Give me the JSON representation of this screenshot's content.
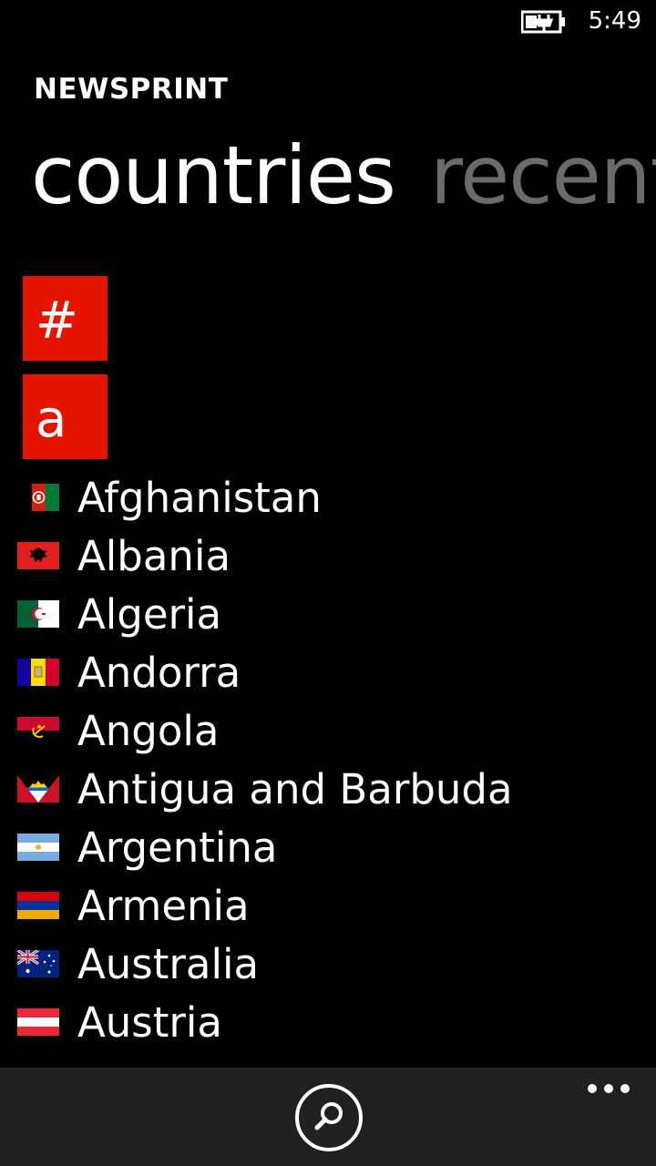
{
  "status_bar": {
    "time": "5:49",
    "battery_icon": "battery-charging-icon"
  },
  "app": {
    "title": "NEWSPRINT"
  },
  "pivot": {
    "items": [
      "countries",
      "recent"
    ],
    "active_index": 0
  },
  "jump_tiles": [
    "#",
    "a"
  ],
  "countries": [
    {
      "name": "Afghanistan",
      "flag": "afghanistan-flag-icon"
    },
    {
      "name": "Albania",
      "flag": "albania-flag-icon"
    },
    {
      "name": "Algeria",
      "flag": "algeria-flag-icon"
    },
    {
      "name": "Andorra",
      "flag": "andorra-flag-icon"
    },
    {
      "name": "Angola",
      "flag": "angola-flag-icon"
    },
    {
      "name": "Antigua and Barbuda",
      "flag": "antigua-and-barbuda-flag-icon"
    },
    {
      "name": "Argentina",
      "flag": "argentina-flag-icon"
    },
    {
      "name": "Armenia",
      "flag": "armenia-flag-icon"
    },
    {
      "name": "Australia",
      "flag": "australia-flag-icon"
    },
    {
      "name": "Austria",
      "flag": "austria-flag-icon"
    }
  ],
  "app_bar": {
    "search_icon": "search-icon",
    "more_icon": "more-ellipsis-icon"
  },
  "colors": {
    "accent": "#e51400",
    "background": "#000000",
    "app_bar": "#212121",
    "inactive_pivot": "#6b6b6b"
  }
}
